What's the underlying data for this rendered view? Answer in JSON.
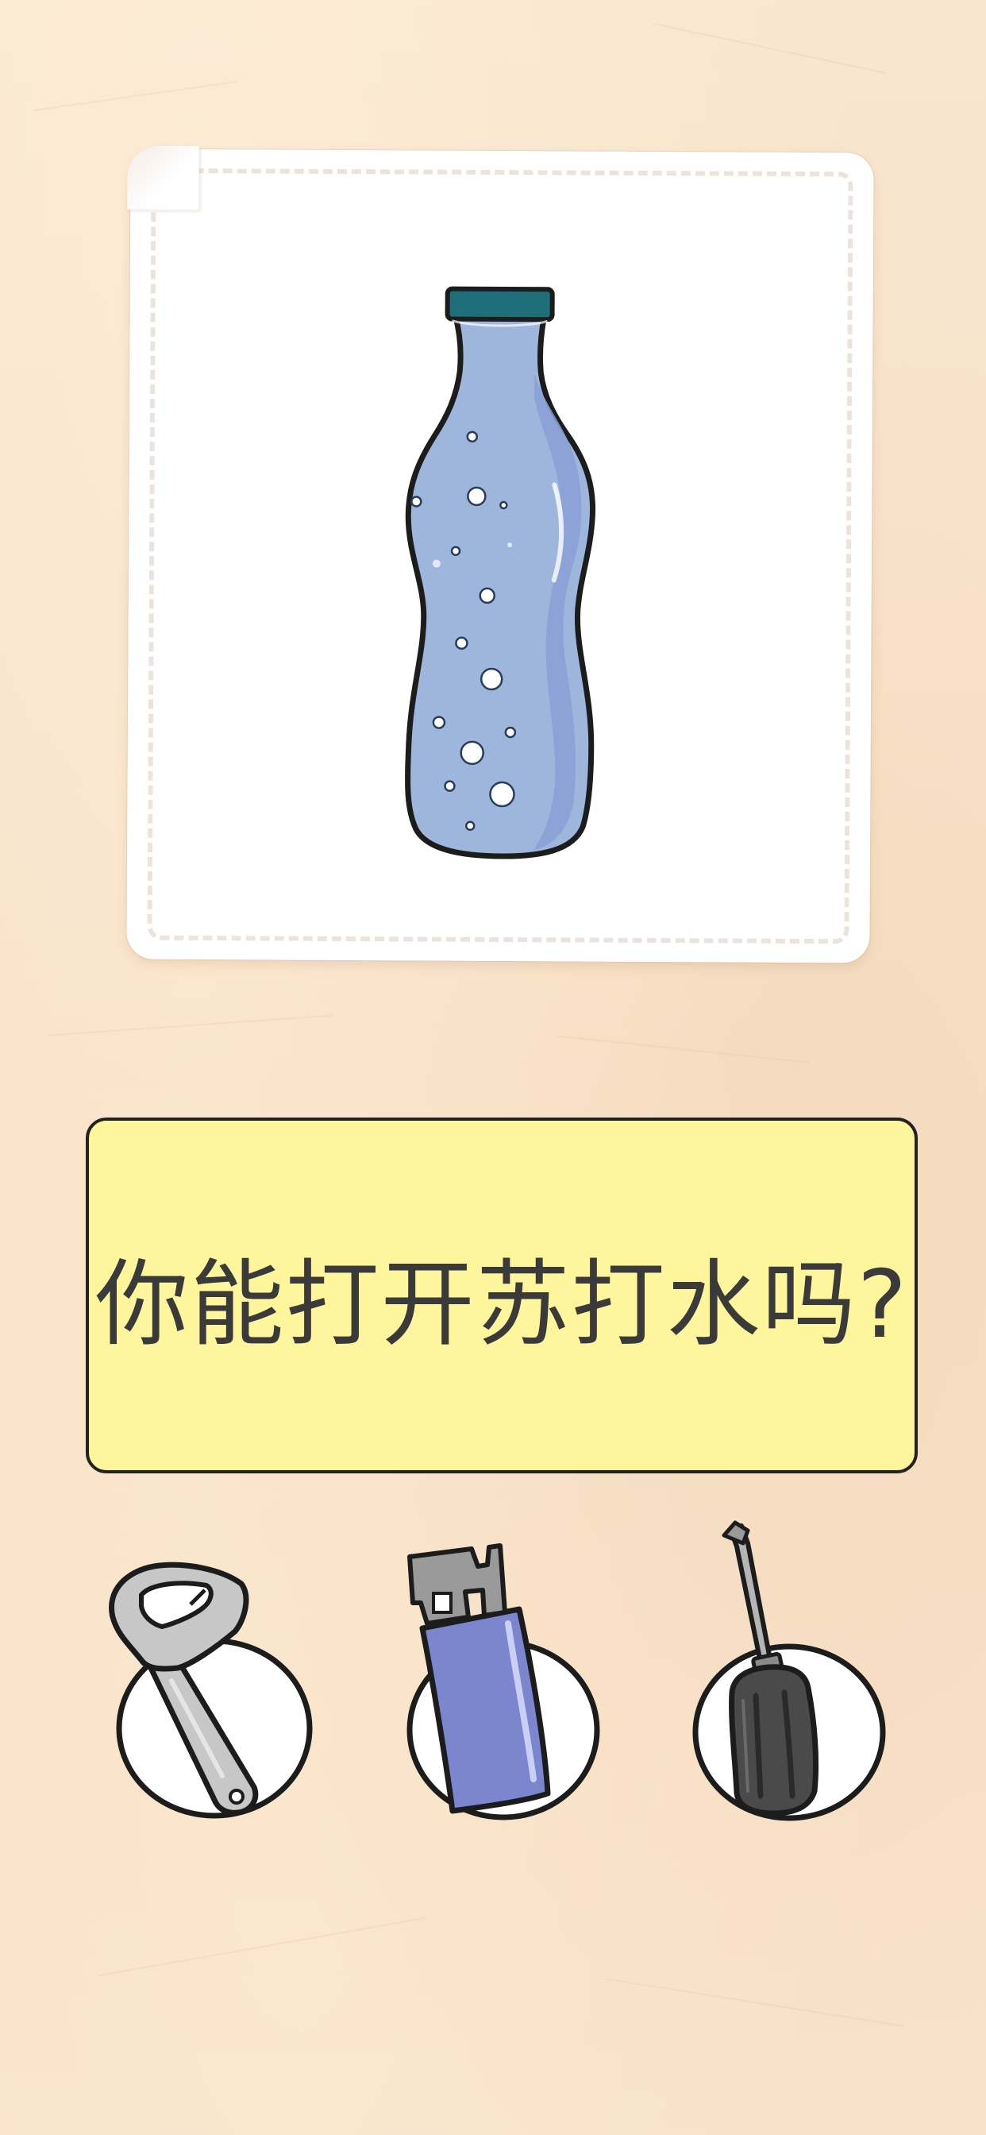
{
  "question": {
    "text": "你能打开苏打水吗?"
  },
  "card": {
    "item_icon": "soda-water-bottle"
  },
  "options": [
    {
      "icon": "bottle-opener-icon"
    },
    {
      "icon": "lighter-icon"
    },
    {
      "icon": "screwdriver-icon"
    }
  ],
  "colors": {
    "background": "#f8e4cc",
    "question_box": "#fff59c",
    "bottle_body": "#9fb6dc",
    "bottle_cap": "#1f6f7a",
    "lighter_body": "#7b86cf",
    "opener_metal": "#c7c7c7",
    "screwdriver_handle": "#4a4a4a"
  }
}
